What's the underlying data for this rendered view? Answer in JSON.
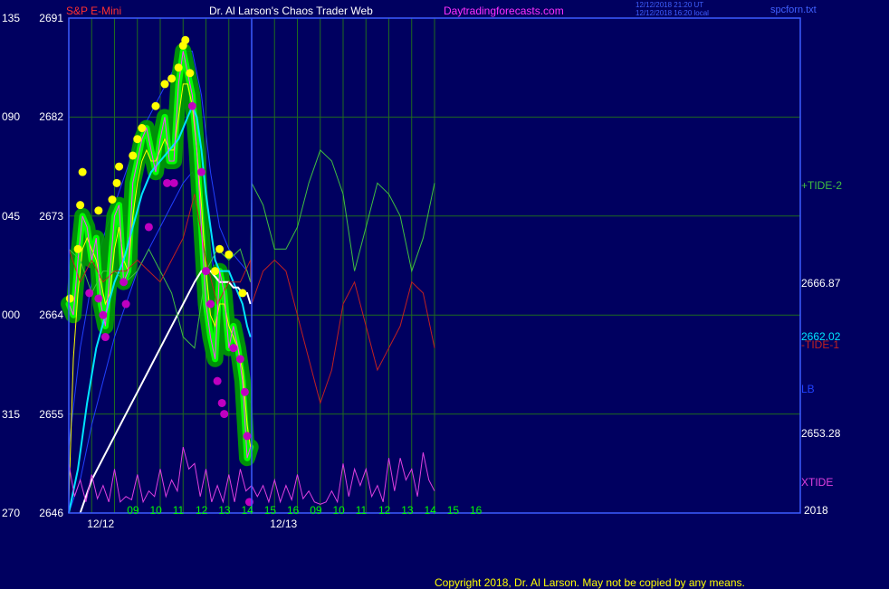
{
  "header": {
    "symbol": "S&P E-Mini",
    "title": "Dr. Al Larson's Chaos Trader Web",
    "site": "Daytradingforecasts.com",
    "timestamp_1": "12/12/2018 21:20 UT",
    "timestamp_2": "12/12/2018 16:20 local",
    "filename": "spcforn.txt"
  },
  "footer": {
    "copyright": "Copyright 2018, Dr. Al Larson. May not be copied by any means."
  },
  "colors": {
    "background": "#000060",
    "plot_border": "#3c5cff",
    "grid": "#1f6a1f",
    "price_bar": "#00ff00",
    "price_halo": "#00a000",
    "high_marker": "#ffff00",
    "low_marker": "#c000c0",
    "fast_avg": "#ffff00",
    "mid_avg": "#00e5ff",
    "slow_avg": "#ffffff",
    "tide_plus": "#40c040",
    "tide_minus": "#c02020",
    "xtide": "#e040e0",
    "band": "#2040ff"
  },
  "chart_data": {
    "type": "line",
    "title": "S&P E-Mini",
    "y_axis": {
      "range": [
        2646,
        2691
      ],
      "ticks": [
        {
          "left": "270",
          "right": "2646",
          "value": 2646
        },
        {
          "left": "315",
          "right": "2655",
          "value": 2655
        },
        {
          "left": "000",
          "right": "2664",
          "value": 2664
        },
        {
          "left": "045",
          "right": "2673",
          "value": 2673
        },
        {
          "left": "090",
          "right": "2682",
          "value": 2682
        },
        {
          "left": "135",
          "right": "2691",
          "value": 2691
        }
      ]
    },
    "x_axis": {
      "range": [
        8,
        40
      ],
      "hour_ticks": [
        {
          "label": "09",
          "x": 9
        },
        {
          "label": "10",
          "x": 10
        },
        {
          "label": "11",
          "x": 11
        },
        {
          "label": "12",
          "x": 12
        },
        {
          "label": "13",
          "x": 13
        },
        {
          "label": "14",
          "x": 14
        },
        {
          "label": "15",
          "x": 15
        },
        {
          "label": "16",
          "x": 16
        },
        {
          "label": "09",
          "x": 17
        },
        {
          "label": "10",
          "x": 18
        },
        {
          "label": "11",
          "x": 19
        },
        {
          "label": "12",
          "x": 20
        },
        {
          "label": "13",
          "x": 21
        },
        {
          "label": "14",
          "x": 22
        },
        {
          "label": "15",
          "x": 23
        },
        {
          "label": "16",
          "x": 24
        }
      ],
      "date_labels": [
        {
          "label": "12/12",
          "x": 8.8
        },
        {
          "label": "12/13",
          "x": 16.8
        }
      ],
      "year_label": "2018",
      "day_separator_x": 16
    },
    "right_labels": [
      {
        "text": "+TIDE-2",
        "color": "#40c040",
        "value": 2675.8
      },
      {
        "text": "2666.87",
        "color": "#ffffff",
        "value": 2666.87
      },
      {
        "text": "2662.02",
        "color": "#00e5ff",
        "value": 2662.02
      },
      {
        "text": "-TIDE-1",
        "color": "#c02020",
        "value": 2661.3
      },
      {
        "text": "LB",
        "color": "#2040ff",
        "value": 2657.3
      },
      {
        "text": "2653.28",
        "color": "#ffffff",
        "value": 2653.28
      },
      {
        "text": "XTIDE",
        "color": "#e040e0",
        "value": 2648.8
      }
    ],
    "series": [
      {
        "name": "Price",
        "color": "#00ff00",
        "x": [
          8.0,
          8.2,
          8.4,
          8.6,
          8.8,
          9.0,
          9.2,
          9.4,
          9.6,
          9.8,
          10.0,
          10.2,
          10.4,
          10.6,
          10.8,
          11.0,
          11.2,
          11.4,
          11.6,
          11.8,
          12.0,
          12.2,
          12.4,
          12.6,
          12.8,
          13.0,
          13.2,
          13.4,
          13.6,
          13.8,
          14.0,
          14.2,
          14.4,
          14.6,
          14.8,
          15.0,
          15.2,
          15.4,
          15.6,
          15.8,
          15.95
        ],
        "y": [
          2665,
          2664,
          2669,
          2673,
          2672,
          2669,
          2671,
          2665,
          2663,
          2668,
          2673,
          2674,
          2667,
          2668,
          2676,
          2678,
          2680,
          2681,
          2679,
          2677,
          2680,
          2682,
          2678,
          2678,
          2685,
          2688,
          2686,
          2684,
          2679,
          2672,
          2665,
          2662,
          2660,
          2668,
          2666,
          2661,
          2663,
          2661,
          2658,
          2651,
          2652
        ]
      },
      {
        "name": "Fast Avg",
        "color": "#ffff00",
        "x": [
          8.0,
          8.2,
          8.4,
          8.6,
          8.8,
          9.0,
          9.2,
          9.4,
          9.6,
          9.8,
          10.0,
          10.2,
          10.4,
          10.6,
          10.8,
          11.0,
          11.2,
          11.4,
          11.6,
          11.8,
          12.0,
          12.2,
          12.4,
          12.6,
          12.8,
          13.0,
          13.2,
          13.4,
          13.6,
          13.8,
          14.0,
          14.2,
          14.4,
          14.6,
          14.8,
          15.0,
          15.2,
          15.4,
          15.6,
          15.8,
          15.95
        ],
        "y": [
          2647,
          2660,
          2666,
          2670,
          2671,
          2670,
          2669,
          2667,
          2665,
          2666,
          2670,
          2672,
          2669,
          2668,
          2673,
          2676,
          2678,
          2679,
          2678,
          2678,
          2679,
          2680,
          2679,
          2679,
          2682,
          2685,
          2685,
          2683,
          2679,
          2674,
          2668,
          2664,
          2663,
          2665,
          2665,
          2663,
          2662,
          2661,
          2659,
          2654,
          2652
        ]
      },
      {
        "name": "Mid Avg",
        "color": "#00e5ff",
        "x": [
          8.0,
          8.4,
          8.8,
          9.2,
          9.6,
          10.0,
          10.4,
          10.8,
          11.2,
          11.6,
          12.0,
          12.4,
          12.8,
          13.0,
          13.2,
          13.4,
          13.6,
          13.8,
          14.0,
          14.2,
          14.4,
          14.6,
          14.8,
          15.0,
          15.2,
          15.4,
          15.6,
          15.8,
          15.95
        ],
        "y": [
          2646,
          2650,
          2656,
          2661,
          2664,
          2667,
          2669,
          2672,
          2675,
          2677,
          2678,
          2679,
          2680,
          2681,
          2682,
          2683,
          2682,
          2679,
          2675,
          2672,
          2669,
          2668,
          2668,
          2668,
          2667,
          2666,
          2665,
          2663,
          2662
        ]
      },
      {
        "name": "Slow Avg",
        "color": "#ffffff",
        "x": [
          8.5,
          9.0,
          9.5,
          10.0,
          10.5,
          11.0,
          11.5,
          12.0,
          12.5,
          13.0,
          13.5,
          13.8,
          14.0,
          14.2,
          14.4,
          14.6,
          14.8,
          15.0,
          15.2,
          15.4,
          15.6,
          15.8,
          15.95
        ],
        "y": [
          2646,
          2649,
          2651,
          2653,
          2655,
          2657,
          2659,
          2661,
          2663,
          2665,
          2667,
          2668,
          2668,
          2668,
          2667.5,
          2667,
          2667,
          2667,
          2666.5,
          2666.5,
          2666,
          2666,
          2665
        ]
      },
      {
        "name": "+TIDE-2",
        "color": "#40c040",
        "x": [
          8.0,
          8.5,
          9.0,
          9.5,
          10.0,
          10.5,
          11.0,
          11.5,
          12.0,
          12.5,
          13.0,
          13.5,
          14.0,
          14.5,
          15.0,
          15.5,
          15.95,
          16.0,
          16.5,
          17.0,
          17.5,
          18.0,
          18.5,
          19.0,
          19.5,
          20.0,
          20.5,
          21.0,
          21.5,
          22.0,
          22.5,
          23.0,
          23.5,
          24.0
        ],
        "y": [
          2670,
          2669,
          2666,
          2668,
          2668,
          2667,
          2668,
          2670,
          2668,
          2666,
          2662,
          2661,
          2668,
          2670,
          2669,
          2670,
          2667,
          2676,
          2674,
          2670,
          2670,
          2672,
          2676,
          2679,
          2678,
          2675,
          2668,
          2672,
          2676,
          2675,
          2673,
          2668,
          2671,
          2676
        ]
      },
      {
        "name": "-TIDE-1",
        "color": "#c02020",
        "x": [
          8.0,
          8.5,
          9.0,
          9.5,
          10.0,
          10.5,
          11.0,
          11.5,
          12.0,
          12.5,
          13.0,
          13.5,
          14.0,
          14.5,
          15.0,
          15.5,
          15.95,
          16.0,
          16.5,
          17.0,
          17.5,
          18.0,
          18.5,
          19.0,
          19.5,
          20.0,
          20.5,
          21.0,
          21.5,
          22.0,
          22.5,
          23.0,
          23.5,
          24.0
        ],
        "y": [
          2670,
          2667,
          2669,
          2667,
          2668,
          2668,
          2669,
          2668,
          2667,
          2669,
          2671,
          2675,
          2669,
          2665,
          2667,
          2667,
          2669,
          2665,
          2668,
          2669,
          2668,
          2664,
          2660,
          2656,
          2659,
          2665,
          2667,
          2663,
          2659,
          2661,
          2663,
          2667,
          2666,
          2661
        ]
      },
      {
        "name": "Upper Band",
        "color": "#2040ff",
        "x": [
          8.0,
          8.5,
          9.0,
          9.5,
          10.0,
          10.5,
          11.0,
          11.5,
          12.0,
          12.5,
          13.0,
          13.4,
          13.8,
          14.2,
          14.6,
          15.0,
          15.4,
          15.8,
          15.95
        ],
        "y": [
          2652,
          2661,
          2667,
          2671,
          2674,
          2677,
          2680,
          2682,
          2684,
          2686,
          2688,
          2688,
          2684,
          2677,
          2672,
          2670,
          2669,
          2668,
          2667
        ]
      },
      {
        "name": "Lower Band",
        "color": "#2040ff",
        "x": [
          8.0,
          8.5,
          9.0,
          9.5,
          10.0,
          10.5,
          11.0,
          11.5,
          12.0,
          12.5,
          13.0,
          13.4,
          13.8,
          14.2,
          14.6,
          15.0,
          15.4,
          15.8,
          15.95
        ],
        "y": [
          2646,
          2649,
          2654,
          2658,
          2662,
          2665,
          2668,
          2670,
          2672,
          2674,
          2676,
          2677,
          2675,
          2670,
          2665,
          2662,
          2659,
          2657,
          2656
        ]
      },
      {
        "name": "XTIDE",
        "color": "#e040e0",
        "x": [
          8.0,
          8.25,
          8.5,
          8.75,
          9.0,
          9.25,
          9.5,
          9.75,
          10.0,
          10.25,
          10.5,
          10.75,
          11.0,
          11.25,
          11.5,
          11.75,
          12.0,
          12.25,
          12.5,
          12.75,
          13.0,
          13.25,
          13.5,
          13.75,
          14.0,
          14.25,
          14.5,
          14.75,
          15.0,
          15.25,
          15.5,
          15.75,
          16.0,
          16.25,
          16.5,
          16.75,
          17.0,
          17.25,
          17.5,
          17.75,
          18.0,
          18.25,
          18.5,
          18.75,
          19.0,
          19.25,
          19.5,
          19.75,
          20.0,
          20.25,
          20.5,
          20.75,
          21.0,
          21.25,
          21.5,
          21.75,
          22.0,
          22.25,
          22.5,
          22.75,
          23.0,
          23.25,
          23.5,
          23.75,
          24.0
        ],
        "y": [
          2650.5,
          2647.5,
          2649,
          2647,
          2649.5,
          2647.3,
          2648.5,
          2647,
          2650,
          2647,
          2647.5,
          2647.2,
          2649.5,
          2647,
          2648,
          2647.5,
          2650,
          2647.5,
          2649,
          2648,
          2652,
          2650,
          2650.5,
          2647.5,
          2650,
          2647,
          2648.5,
          2647,
          2649.5,
          2647,
          2650,
          2648,
          2648.5,
          2647.5,
          2648.5,
          2647,
          2649,
          2647,
          2648.5,
          2647.2,
          2649.5,
          2647.3,
          2648,
          2647,
          2646.8,
          2647,
          2648,
          2647,
          2650.5,
          2647.5,
          2650,
          2648.5,
          2650,
          2647.5,
          2648.5,
          2647,
          2651,
          2648,
          2651,
          2649,
          2650,
          2647.5,
          2651.5,
          2649,
          2648
        ]
      }
    ],
    "markers": {
      "highs": [
        {
          "x": 8.05,
          "y": 2665.5
        },
        {
          "x": 8.4,
          "y": 2670
        },
        {
          "x": 8.5,
          "y": 2674
        },
        {
          "x": 8.6,
          "y": 2677
        },
        {
          "x": 9.3,
          "y": 2673.5
        },
        {
          "x": 9.9,
          "y": 2674.5
        },
        {
          "x": 10.1,
          "y": 2676
        },
        {
          "x": 10.2,
          "y": 2677.5
        },
        {
          "x": 10.8,
          "y": 2678.5
        },
        {
          "x": 11.0,
          "y": 2680
        },
        {
          "x": 11.2,
          "y": 2681
        },
        {
          "x": 11.8,
          "y": 2683
        },
        {
          "x": 12.2,
          "y": 2685
        },
        {
          "x": 12.5,
          "y": 2685.5
        },
        {
          "x": 12.8,
          "y": 2686.5
        },
        {
          "x": 13.0,
          "y": 2688.5
        },
        {
          "x": 13.1,
          "y": 2689
        },
        {
          "x": 13.3,
          "y": 2686
        },
        {
          "x": 14.4,
          "y": 2668
        },
        {
          "x": 14.6,
          "y": 2670
        },
        {
          "x": 15.0,
          "y": 2669.5
        },
        {
          "x": 15.6,
          "y": 2666
        }
      ],
      "lows": [
        {
          "x": 8.9,
          "y": 2666
        },
        {
          "x": 9.3,
          "y": 2665.5
        },
        {
          "x": 9.5,
          "y": 2664
        },
        {
          "x": 9.6,
          "y": 2662
        },
        {
          "x": 10.4,
          "y": 2667
        },
        {
          "x": 10.5,
          "y": 2665
        },
        {
          "x": 11.5,
          "y": 2672
        },
        {
          "x": 12.3,
          "y": 2676
        },
        {
          "x": 12.6,
          "y": 2676
        },
        {
          "x": 13.4,
          "y": 2683
        },
        {
          "x": 13.8,
          "y": 2677
        },
        {
          "x": 14.0,
          "y": 2668
        },
        {
          "x": 14.2,
          "y": 2665
        },
        {
          "x": 14.5,
          "y": 2658
        },
        {
          "x": 14.7,
          "y": 2656
        },
        {
          "x": 14.8,
          "y": 2655
        },
        {
          "x": 15.2,
          "y": 2661
        },
        {
          "x": 15.5,
          "y": 2660
        },
        {
          "x": 15.7,
          "y": 2657
        },
        {
          "x": 15.8,
          "y": 2653
        },
        {
          "x": 15.9,
          "y": 2647
        }
      ]
    }
  }
}
